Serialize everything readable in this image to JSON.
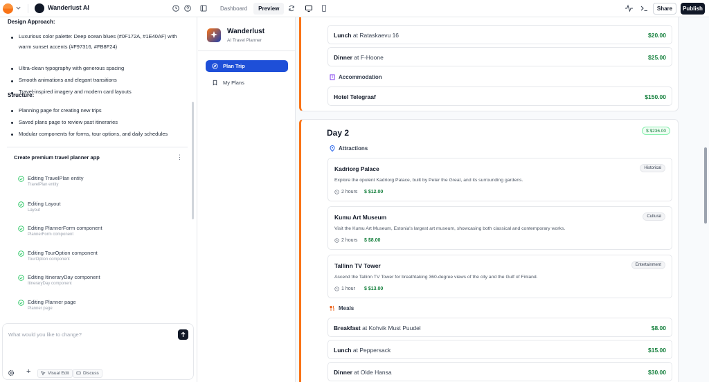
{
  "topbar": {
    "project_name": "Wanderlust AI",
    "tabs": [
      {
        "label": "Dashboard",
        "active": false
      },
      {
        "label": "Preview",
        "active": true
      }
    ],
    "share_label": "Share",
    "publish_label": "Publish",
    "icons": [
      "history-icon",
      "help-icon",
      "layout-icon",
      "refresh-icon",
      "desktop-icon",
      "mobile-icon",
      "activity-icon",
      "terminal-icon"
    ]
  },
  "chat": {
    "design_heading": "Design Approach:",
    "design_items": [
      "Luxurious color palette: Deep ocean blues (#0F172A, #1E40AF) with warm sunset accents (#F97316, #FB8F24)",
      "Ultra-clean typography with generous spacing",
      "Smooth animations and elegant transitions",
      "Travel-inspired imagery and modern card layouts"
    ],
    "structure_heading": "Structure:",
    "structure_items": [
      "Planning page for creating new trips",
      "Saved plans page to review past itineraries",
      "Modular components for forms, tour options, and daily schedules"
    ],
    "card_title": "Create premium travel planner app",
    "steps": [
      {
        "title": "Editing TravelPlan entity",
        "sub": "TravelPlan entity"
      },
      {
        "title": "Editing Layout",
        "sub": "Layout"
      },
      {
        "title": "Editing PlannerForm component",
        "sub": "PlannerForm component"
      },
      {
        "title": "Editing TourOption component",
        "sub": "TourOption component"
      },
      {
        "title": "Editing ItineraryDay component",
        "sub": "ItineraryDay component"
      },
      {
        "title": "Editing Planner page",
        "sub": "Planner page"
      }
    ],
    "input_placeholder": "What would you like to change?",
    "visual_edit_label": "Visual Edit",
    "discuss_label": "Discuss"
  },
  "app": {
    "title": "Wanderlust",
    "subtitle": "AI Travel Planner",
    "nav": [
      {
        "label": "Plan Trip",
        "active": true
      },
      {
        "label": "My Plans",
        "active": false
      }
    ]
  },
  "itinerary": {
    "day1": {
      "meals": [
        {
          "type": "Lunch",
          "place": "at Rataskaevu 16",
          "price": "$20.00"
        },
        {
          "type": "Dinner",
          "place": "at F-Hoone",
          "price": "$25.00"
        }
      ],
      "accommodation_label": "Accommodation",
      "hotel": {
        "name": "Hotel Telegraaf",
        "price": "$150.00"
      }
    },
    "day2": {
      "title": "Day 2",
      "total": "$ $236.00",
      "attractions_label": "Attractions",
      "attractions": [
        {
          "name": "Kadriorg Palace",
          "desc": "Explore the opulent Kadriorg Palace, built by Peter the Great, and its surrounding gardens.",
          "tag": "Historical",
          "duration": "2 hours",
          "price": "$12.00"
        },
        {
          "name": "Kumu Art Museum",
          "desc": "Visit the Kumu Art Museum, Estonia's largest art museum, showcasing both classical and contemporary works.",
          "tag": "Cultural",
          "duration": "2 hours",
          "price": "$8.00"
        },
        {
          "name": "Tallinn TV Tower",
          "desc": "Ascend the Tallinn TV Tower for breathtaking 360-degree views of the city and the Gulf of Finland.",
          "tag": "Entertainment",
          "duration": "1 hour",
          "price": "$13.00"
        }
      ],
      "meals_label": "Meals",
      "meals": [
        {
          "type": "Breakfast",
          "place": "at Kohvik Must Puudel",
          "price": "$8.00"
        },
        {
          "type": "Lunch",
          "place": "at Peppersack",
          "price": "$15.00"
        },
        {
          "type": "Dinner",
          "place": "at Olde Hansa",
          "price": "$30.00"
        }
      ]
    }
  },
  "colors": {
    "accent": "#f97316",
    "primary": "#1e4fd8",
    "price": "#15803d"
  }
}
